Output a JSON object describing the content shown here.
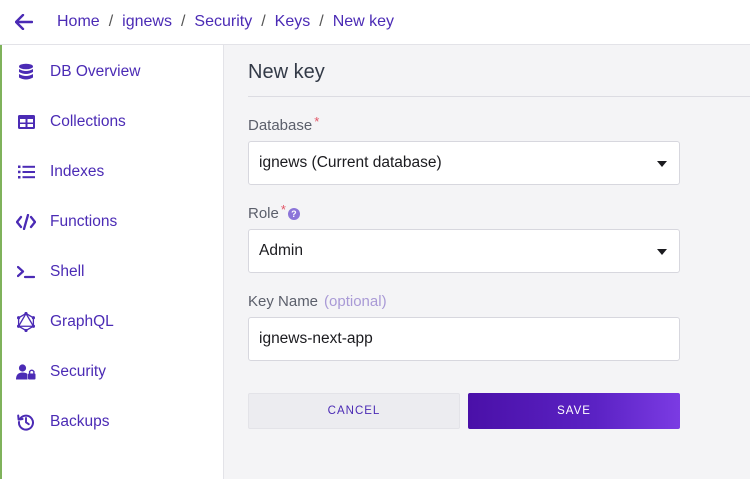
{
  "breadcrumb": {
    "items": [
      "Home",
      "ignews",
      "Security",
      "Keys",
      "New key"
    ],
    "separator": "/"
  },
  "sidebar": {
    "items": [
      {
        "label": "DB Overview",
        "icon": "database-icon"
      },
      {
        "label": "Collections",
        "icon": "table-icon"
      },
      {
        "label": "Indexes",
        "icon": "list-icon"
      },
      {
        "label": "Functions",
        "icon": "code-icon"
      },
      {
        "label": "Shell",
        "icon": "terminal-icon"
      },
      {
        "label": "GraphQL",
        "icon": "graphql-icon"
      },
      {
        "label": "Security",
        "icon": "user-lock-icon"
      },
      {
        "label": "Backups",
        "icon": "history-icon"
      }
    ]
  },
  "main": {
    "title": "New key",
    "database": {
      "label": "Database",
      "required_mark": "*",
      "value": "ignews (Current database)"
    },
    "role": {
      "label": "Role",
      "required_mark": "*",
      "help": "?",
      "value": "Admin"
    },
    "key_name": {
      "label": "Key Name",
      "optional": "(optional)",
      "value": "ignews-next-app"
    },
    "cancel_label": "CANCEL",
    "save_label": "SAVE"
  },
  "colors": {
    "brand": "#4b2bb5",
    "save_gradient_start": "#4a10a8",
    "save_gradient_end": "#7b3be3",
    "required": "#e25566",
    "accent_edge": "#7fb25b"
  }
}
